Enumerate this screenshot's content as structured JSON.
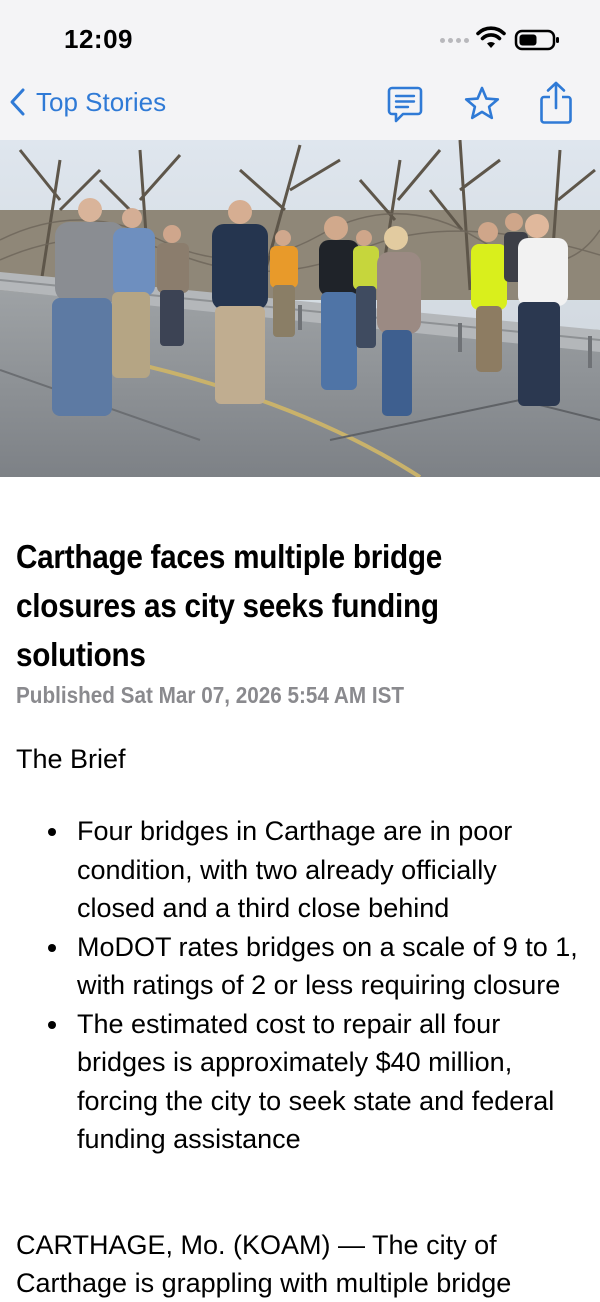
{
  "status_bar": {
    "time": "12:09"
  },
  "nav": {
    "back_label": "Top Stories",
    "icons": [
      "chevron-left-icon",
      "comments-icon",
      "star-icon",
      "share-icon"
    ],
    "accent_color": "#2f7ad6"
  },
  "article": {
    "image": "group of people standing on a closed bridge road",
    "headline": "Carthage faces multiple bridge closures as city seeks funding solutions",
    "published": "Published Sat Mar 07, 2026 5:54 AM IST",
    "brief_heading": "The Brief",
    "brief_items": [
      "Four bridges in Carthage are in poor condition, with two already officially closed and a third close behind",
      "MoDOT rates bridges on a scale of 9 to 1, with ratings of 2 or less requiring closure",
      "The estimated cost to repair all four bridges is approximately $40 million, forcing the city to seek state and federal funding assistance"
    ],
    "body_start": "CARTHAGE, Mo. (KOAM) — The city of Carthage is grappling with multiple bridge"
  }
}
